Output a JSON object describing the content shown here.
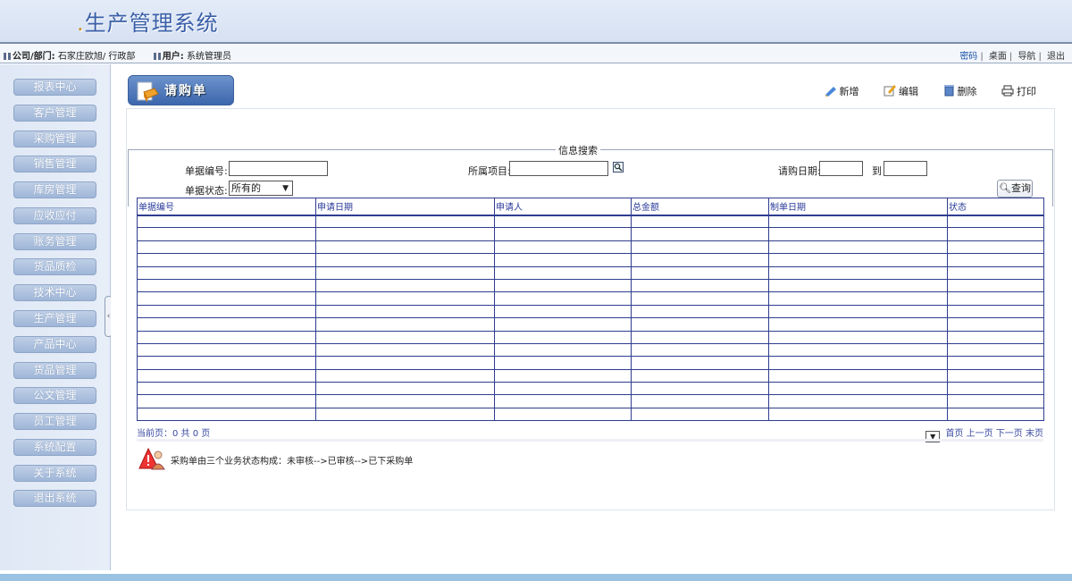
{
  "header": {
    "title_prefix": ".",
    "title": "生产管理系统"
  },
  "infobar": {
    "company_label": "公司/部门:",
    "company_value": "石家庄欧旭/ 行政部",
    "user_label": "用户:",
    "user_value": "系统管理员",
    "links": [
      "密码",
      "桌面",
      "导航",
      "退出"
    ]
  },
  "sidebar": {
    "items": [
      "报表中心",
      "客户管理",
      "采购管理",
      "销售管理",
      "库房管理",
      "应收应付",
      "账务管理",
      "货品质检",
      "技术中心",
      "生产管理",
      "产品中心",
      "货品管理",
      "公文管理",
      "员工管理",
      "系统配置",
      "关于系统",
      "退出系统"
    ]
  },
  "page": {
    "badge": "请购单"
  },
  "toolbar": {
    "add": "新增",
    "edit": "编辑",
    "delete": "删除",
    "print": "打印"
  },
  "search": {
    "legend": "信息搜索",
    "doc_no_label": "单据编号:",
    "project_label": "所属项目:",
    "date_label": "请购日期:",
    "to_label": "到",
    "status_label": "单据状态:",
    "status_value": "所有的",
    "query_button": "查询"
  },
  "table": {
    "columns": [
      "单据编号",
      "申请日期",
      "申请人",
      "总金额",
      "制单日期",
      "状态"
    ],
    "rows": []
  },
  "pager": {
    "info": "当前页：0 共 0 页",
    "first": "首页",
    "prev": "上一页",
    "next": "下一页",
    "last": "末页"
  },
  "note": "采购单由三个业务状态构成：未审核-->已审核-->已下采购单",
  "colors": {
    "accent": "#3c67ad",
    "grid_line": "#2f3d8f",
    "link": "#1a52a8"
  }
}
